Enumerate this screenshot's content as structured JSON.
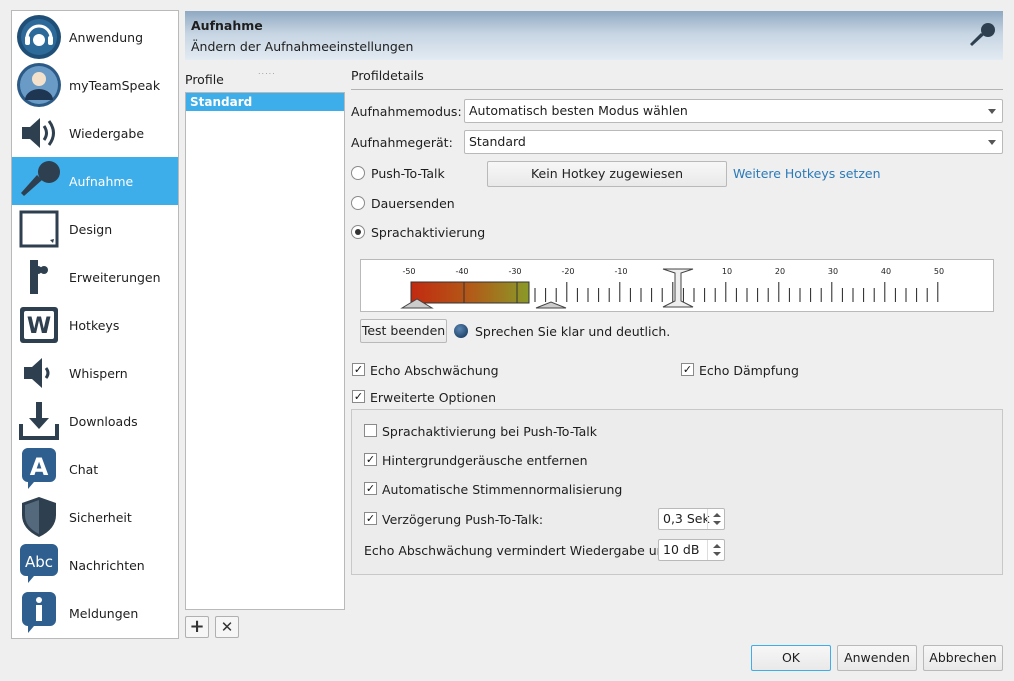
{
  "sidebar": {
    "items": [
      {
        "label": "Anwendung",
        "icon": "headset-icon"
      },
      {
        "label": "myTeamSpeak",
        "icon": "user-icon"
      },
      {
        "label": "Wiedergabe",
        "icon": "speaker-icon"
      },
      {
        "label": "Aufnahme",
        "icon": "microphone-icon",
        "active": true
      },
      {
        "label": "Design",
        "icon": "design-icon"
      },
      {
        "label": "Erweiterungen",
        "icon": "puzzle-icon"
      },
      {
        "label": "Hotkeys",
        "icon": "hotkeys-icon"
      },
      {
        "label": "Whispern",
        "icon": "whisper-icon"
      },
      {
        "label": "Downloads",
        "icon": "download-icon"
      },
      {
        "label": "Chat",
        "icon": "chat-icon"
      },
      {
        "label": "Sicherheit",
        "icon": "shield-icon"
      },
      {
        "label": "Nachrichten",
        "icon": "messages-icon"
      },
      {
        "label": "Meldungen",
        "icon": "info-icon"
      }
    ]
  },
  "header": {
    "title": "Aufnahme",
    "subtitle": "Ändern der Aufnahmeeinstellungen"
  },
  "profiles": {
    "label": "Profile",
    "items": [
      "Standard"
    ],
    "add": "+",
    "remove": "✕"
  },
  "details": {
    "label": "Profildetails",
    "mode_label": "Aufnahmemodus:",
    "mode_value": "Automatisch besten Modus wählen",
    "device_label": "Aufnahmegerät:",
    "device_value": "Standard",
    "ptt_label": "Push-To-Talk",
    "hotkey_button": "Kein Hotkey zugewiesen",
    "more_hotkeys": "Weitere Hotkeys setzen",
    "continuous_label": "Dauersenden",
    "va_label": "Sprachaktivierung",
    "selected_mode": "va",
    "meter_ticks": [
      "-50",
      "-40",
      "-30",
      "-20",
      "-10",
      "10",
      "20",
      "30",
      "40",
      "50"
    ],
    "test_button": "Test beenden",
    "test_hint": "Sprechen Sie klar und deutlich.",
    "echo_reduction": "Echo Abschwächung",
    "echo_reduction_checked": true,
    "echo_cancel": "Echo Dämpfung",
    "echo_cancel_checked": true,
    "advanced": "Erweiterte Optionen",
    "advanced_checked": true,
    "adv": {
      "va_ptt": "Sprachaktivierung bei Push-To-Talk",
      "va_ptt_checked": false,
      "noise": "Hintergrundgeräusche entfernen",
      "noise_checked": true,
      "agc": "Automatische Stimmennormalisierung",
      "agc_checked": true,
      "delay": "Verzögerung Push-To-Talk:",
      "delay_checked": true,
      "delay_value": "0,3 Sek",
      "echo_attn": "Echo Abschwächung vermindert Wiedergabe um:",
      "echo_attn_value": "10 dB"
    }
  },
  "buttons": {
    "ok": "OK",
    "apply": "Anwenden",
    "cancel": "Abbrechen"
  },
  "colors": {
    "accent": "#3daee9",
    "link": "#2a7ab8"
  }
}
